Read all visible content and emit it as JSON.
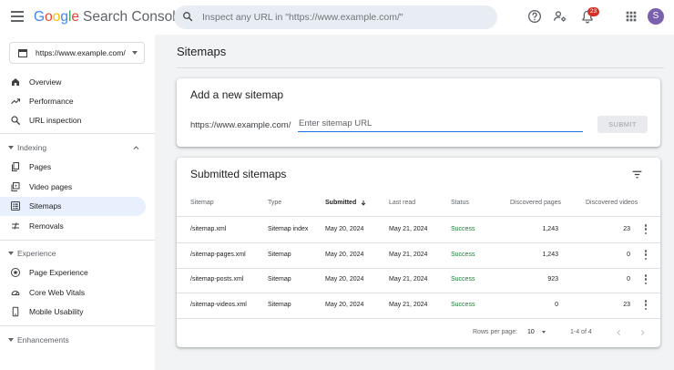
{
  "header": {
    "brand": {
      "letters": [
        {
          "ch": "G",
          "color": "#4285F4"
        },
        {
          "ch": "o",
          "color": "#EA4335"
        },
        {
          "ch": "o",
          "color": "#FBBC05"
        },
        {
          "ch": "g",
          "color": "#4285F4"
        },
        {
          "ch": "l",
          "color": "#34A853"
        },
        {
          "ch": "e",
          "color": "#EA4335"
        }
      ],
      "product": "Search Console"
    },
    "search_placeholder": "Inspect any URL in \"https://www.example.com/\"",
    "icons": [
      "menu-icon",
      "search-icon",
      "help-icon",
      "manage-users-icon",
      "notifications-icon",
      "apps-grid-icon"
    ],
    "notification_count": "23",
    "avatar_letter": "S"
  },
  "sidebar": {
    "property": "https://www.example.com/",
    "top_items": [
      {
        "label": "Overview",
        "icon": "home-icon"
      },
      {
        "label": "Performance",
        "icon": "trending-up-icon"
      },
      {
        "label": "URL inspection",
        "icon": "search-icon"
      }
    ],
    "sections": [
      {
        "label": "Indexing",
        "expanded": true,
        "items": [
          {
            "label": "Pages",
            "icon": "pages-icon"
          },
          {
            "label": "Video pages",
            "icon": "video-icon"
          },
          {
            "label": "Sitemaps",
            "icon": "sitemap-icon",
            "active": true
          },
          {
            "label": "Removals",
            "icon": "removals-icon"
          }
        ]
      },
      {
        "label": "Experience",
        "expanded": true,
        "items": [
          {
            "label": "Page Experience",
            "icon": "page-experience-icon"
          },
          {
            "label": "Core Web Vitals",
            "icon": "speedometer-icon"
          },
          {
            "label": "Mobile Usability",
            "icon": "mobile-icon"
          }
        ]
      },
      {
        "label": "Enhancements",
        "expanded": true,
        "items": []
      }
    ]
  },
  "main": {
    "page_title": "Sitemaps",
    "add_card": {
      "title": "Add a new sitemap",
      "prefix": "https://www.example.com/",
      "input_placeholder": "Enter sitemap URL",
      "input_value": "",
      "submit_label": "SUBMIT"
    },
    "submitted_card": {
      "title": "Submitted sitemaps",
      "columns": [
        "Sitemap",
        "Type",
        "Submitted",
        "Last read",
        "Status",
        "Discovered pages",
        "Discovered videos"
      ],
      "sorted_column": "Submitted",
      "rows": [
        {
          "sitemap": "/sitemap.xml",
          "type": "Sitemap index",
          "submitted": "May 20, 2024",
          "last_read": "May 21, 2024",
          "status": "Success",
          "pages": "1,243",
          "videos": "23"
        },
        {
          "sitemap": "/sitemap-pages.xml",
          "type": "Sitemap",
          "submitted": "May 20, 2024",
          "last_read": "May 21, 2024",
          "status": "Success",
          "pages": "1,243",
          "videos": "0"
        },
        {
          "sitemap": "/sitemap-posts.xml",
          "type": "Sitemap",
          "submitted": "May 20, 2024",
          "last_read": "May 21, 2024",
          "status": "Success",
          "pages": "923",
          "videos": "0"
        },
        {
          "sitemap": "/sitemap-videos.xml",
          "type": "Sitemap",
          "submitted": "May 20, 2024",
          "last_read": "May 21, 2024",
          "status": "Success",
          "pages": "0",
          "videos": "23"
        }
      ],
      "pagination": {
        "rows_per_page_label": "Rows per page:",
        "rows_per_page": "10",
        "range": "1-4 of 4"
      }
    }
  },
  "colors": {
    "accent": "#1a73e8",
    "active_nav_bg": "#e8f0fe",
    "status_success": "#188038",
    "badge": "#d93025",
    "avatar": "#7b61ad"
  }
}
